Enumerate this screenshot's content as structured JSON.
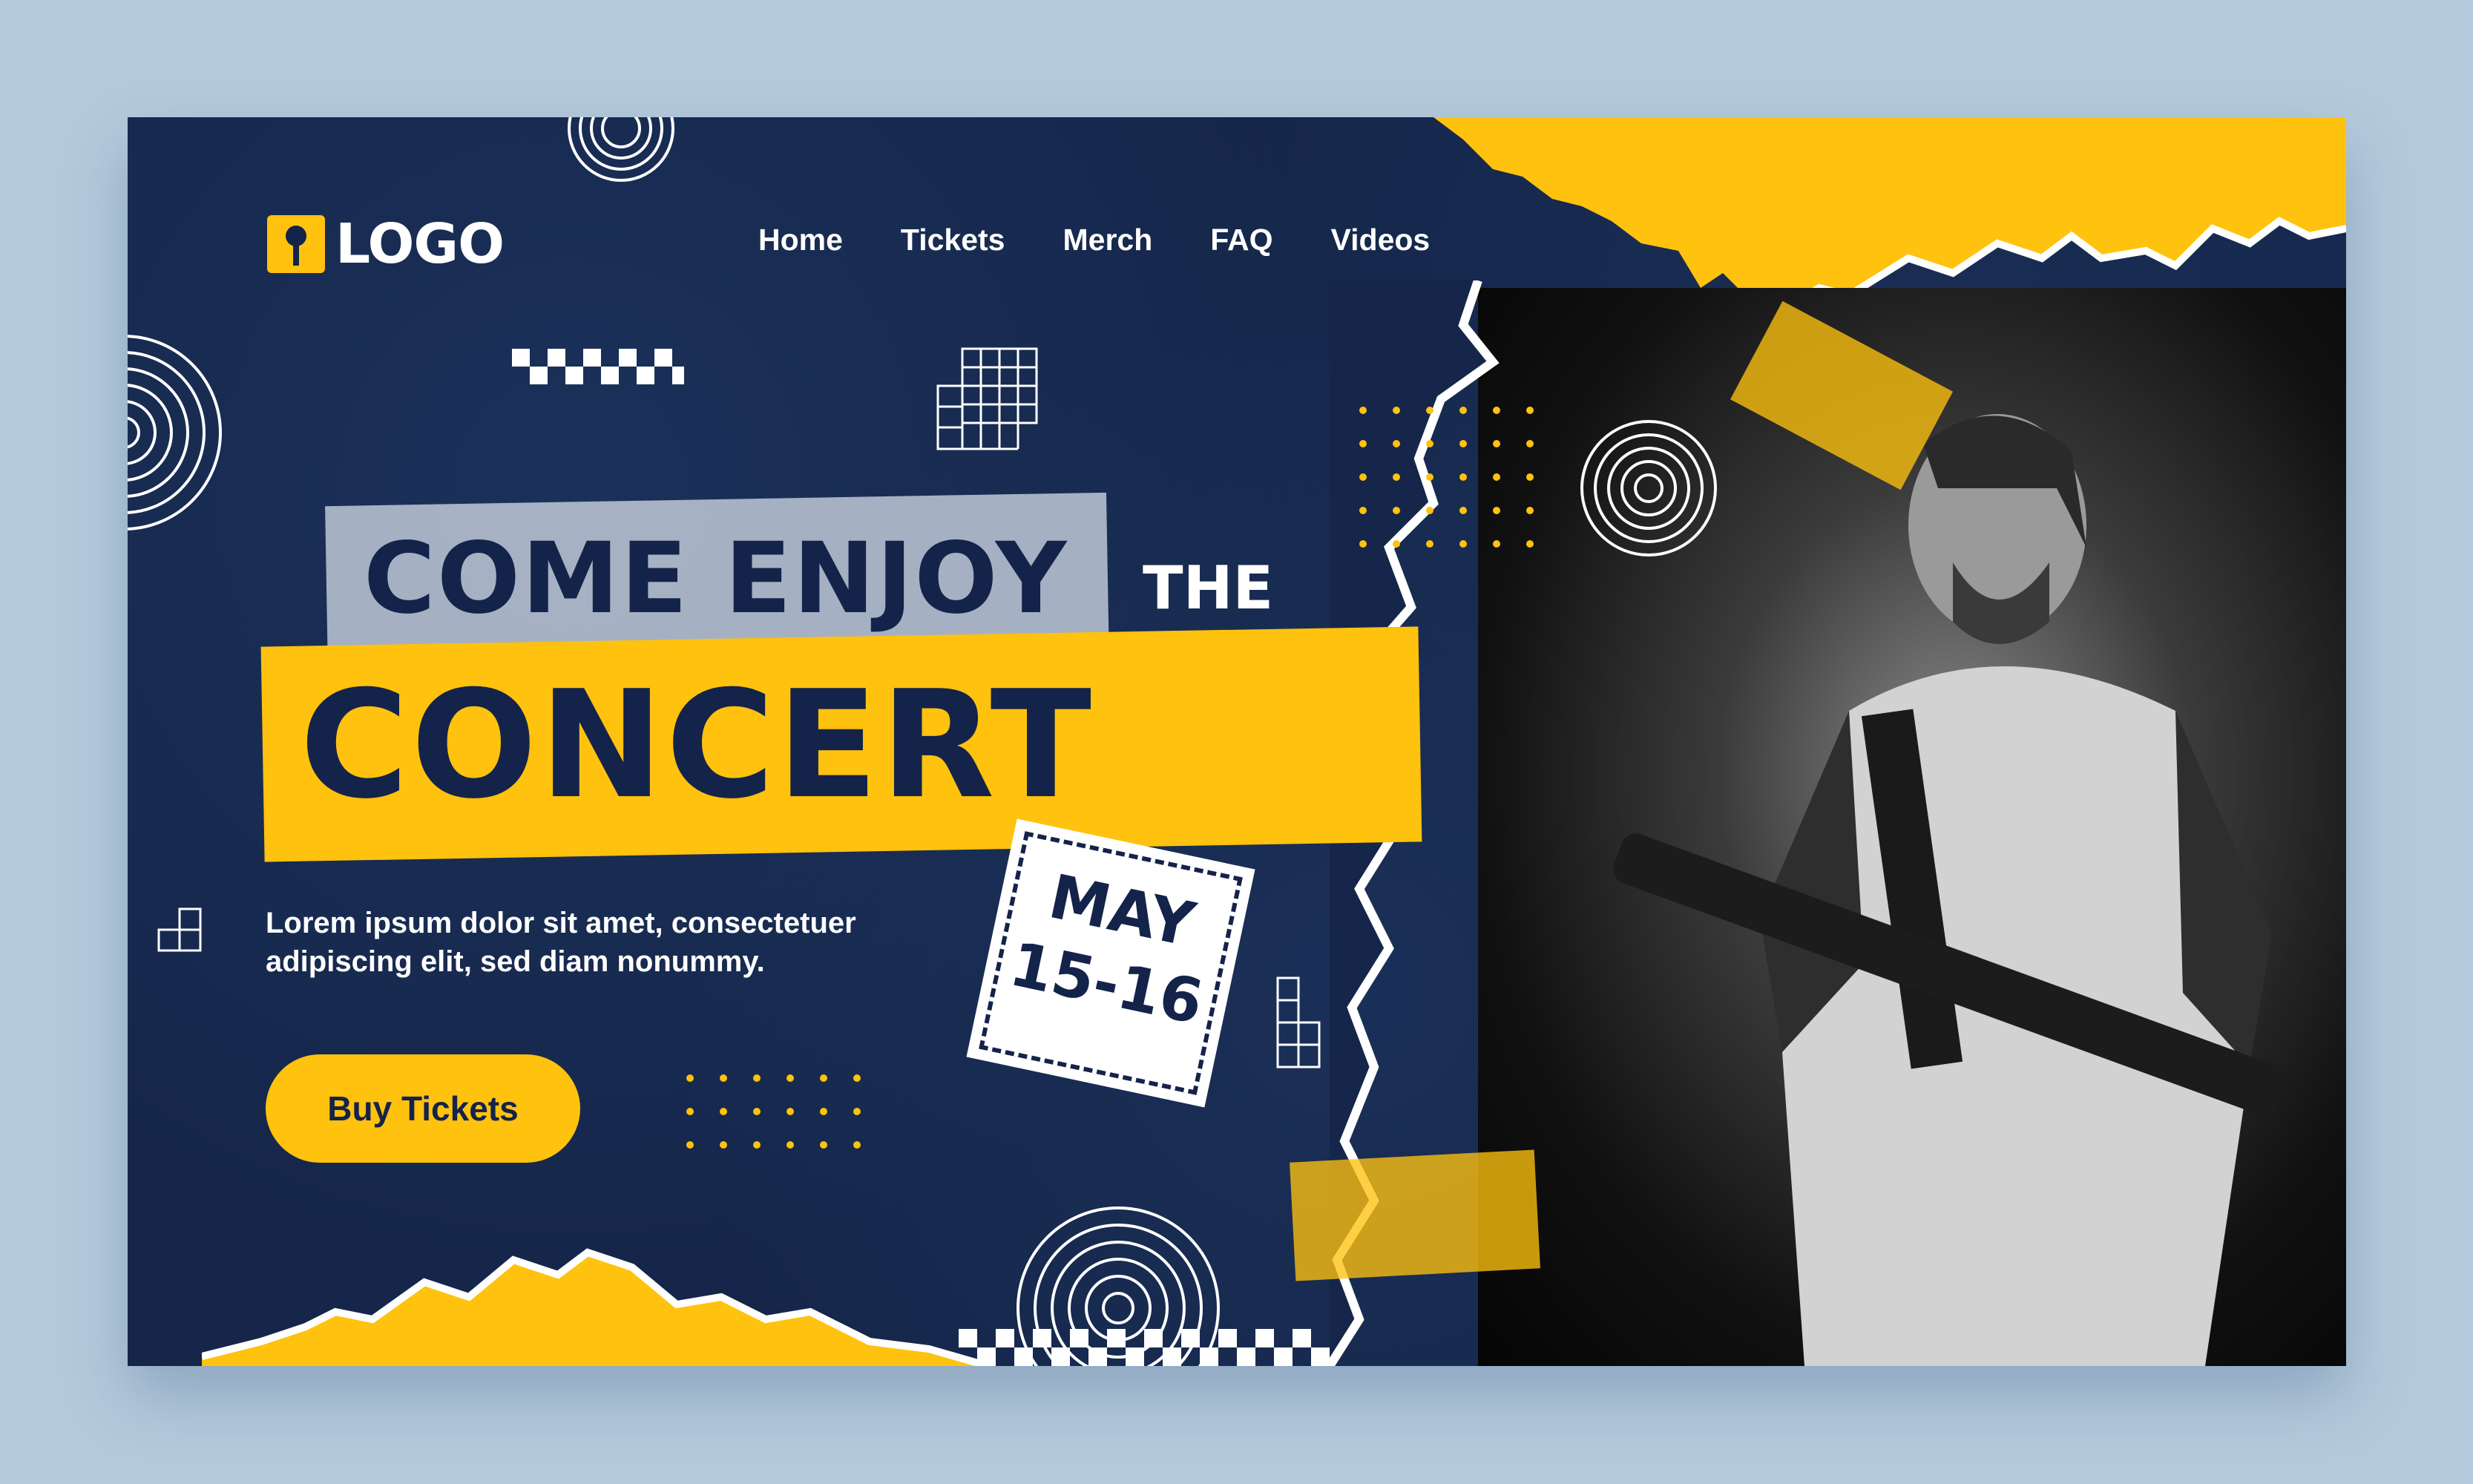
{
  "brand": {
    "logo_text": "LOGO"
  },
  "nav": {
    "items": [
      "Home",
      "Tickets",
      "Merch",
      "FAQ",
      "Videos"
    ]
  },
  "hero": {
    "headline_part1": "COME ENJOY",
    "headline_part2": "THE",
    "headline_part3": "CONCERT",
    "date_line1": "MAY",
    "date_line2": "15-16",
    "description_line1": "Lorem ipsum dolor sit amet, consectetuer",
    "description_line2": "adipiscing elit, sed diam nonummy.",
    "cta_label": "Buy Tickets"
  },
  "colors": {
    "background": "#15264a",
    "accent": "#ffc20e",
    "page": "#b5cadc",
    "text": "#ffffff",
    "dark_text": "#14234a"
  },
  "icons": [
    "microphone-icon",
    "concentric-circles-decoration",
    "grid-decoration",
    "dot-grid-decoration",
    "checker-strip-decoration"
  ]
}
